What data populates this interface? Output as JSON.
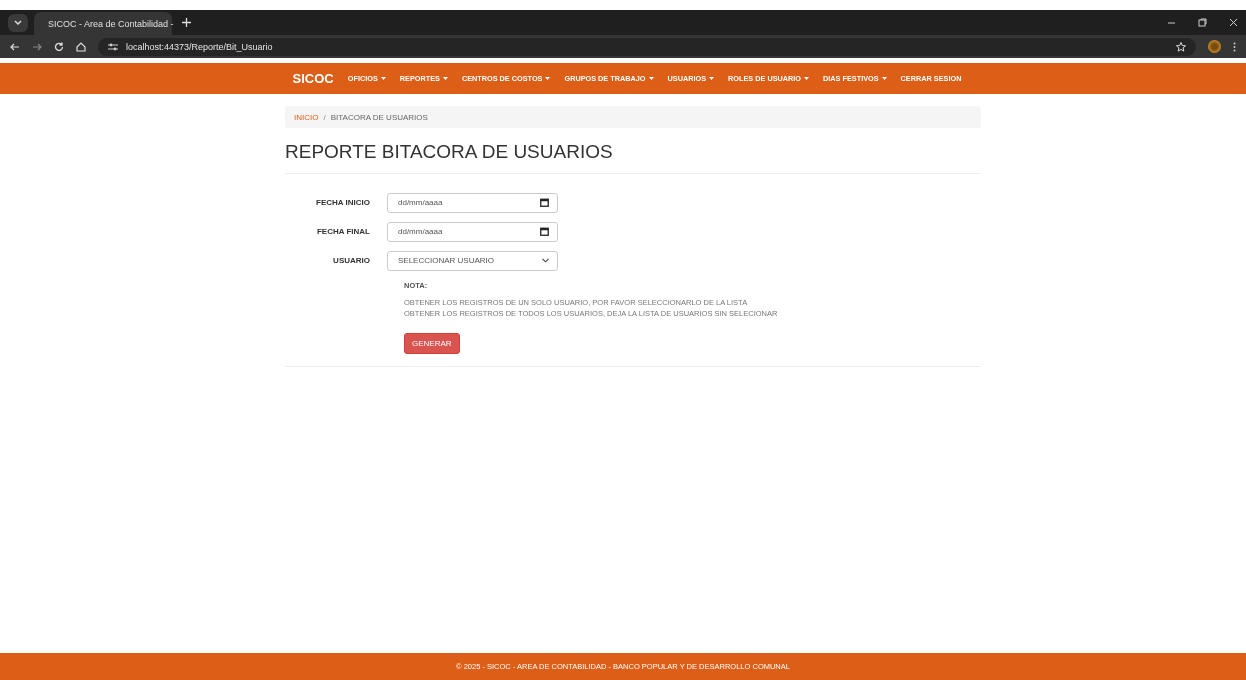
{
  "browser": {
    "tab_title": "SICOC - Area de Contabilidad -",
    "url": "localhost:44373/Reporte/Bit_Usuario"
  },
  "navbar": {
    "brand": "SICOC",
    "items": [
      {
        "label": "OFICIOS",
        "dropdown": true
      },
      {
        "label": "REPORTES",
        "dropdown": true
      },
      {
        "label": "CENTROS DE COSTOS",
        "dropdown": true
      },
      {
        "label": "GRUPOS DE TRABAJO",
        "dropdown": true
      },
      {
        "label": "USUARIOS",
        "dropdown": true
      },
      {
        "label": "ROLES DE USUARIO",
        "dropdown": true
      },
      {
        "label": "DIAS FESTIVOS",
        "dropdown": true
      },
      {
        "label": "CERRAR SESION",
        "dropdown": false
      }
    ]
  },
  "breadcrumb": [
    "INICIO",
    "BITACORA DE USUARIOS"
  ],
  "breadcrumb_separator": "/",
  "heading": "REPORTE BITACORA DE USUARIOS",
  "form": {
    "fields": [
      {
        "label": "FECHA INICIO",
        "kind": "date",
        "placeholder": "dd/mm/aaaa"
      },
      {
        "label": "FECHA FINAL",
        "kind": "date",
        "placeholder": "dd/mm/aaaa"
      },
      {
        "label": "USUARIO",
        "kind": "select",
        "value": "SELECCIONAR USUARIO"
      }
    ],
    "note_title": "NOTA:",
    "note_lines": [
      "OBTENER LOS REGISTROS DE UN SOLO USUARIO, POR FAVOR SELECCIONARLO DE LA LISTA",
      "OBTENER LOS REGISTROS DE TODOS LOS USUARIOS, DEJA LA LISTA DE USUARIOS SIN SELECIONAR"
    ],
    "button": "GENERAR"
  },
  "footer": "© 2025 - SICOC - AREA DE CONTABILIDAD - BANCO POPULAR Y DE DESARROLLO COMUNAL"
}
